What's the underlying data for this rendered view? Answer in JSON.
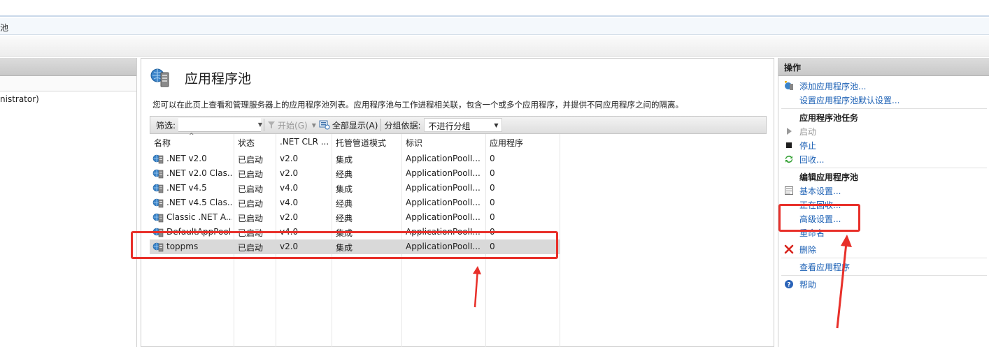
{
  "breadcrumb": "池",
  "connections": {
    "node_text": "nistrator)"
  },
  "content": {
    "title": "应用程序池",
    "description": "您可以在此页上查看和管理服务器上的应用程序池列表。应用程序池与工作进程相关联，包含一个或多个应用程序，并提供不同应用程序之间的隔离。"
  },
  "filter": {
    "label": "筛选:",
    "start_label": "开始(G)",
    "show_all_label": "全部显示(A)",
    "group_label": "分组依据:",
    "group_value": "不进行分组"
  },
  "grid": {
    "columns": [
      "名称",
      "状态",
      ".NET CLR ...",
      "托管管道模式",
      "标识",
      "应用程序"
    ],
    "rows": [
      {
        "name": ".NET v2.0",
        "status": "已启动",
        "clr": "v2.0",
        "pipeline": "集成",
        "identity": "ApplicationPoolI...",
        "apps": "0"
      },
      {
        "name": ".NET v2.0 Clas...",
        "status": "已启动",
        "clr": "v2.0",
        "pipeline": "经典",
        "identity": "ApplicationPoolI...",
        "apps": "0"
      },
      {
        "name": ".NET v4.5",
        "status": "已启动",
        "clr": "v4.0",
        "pipeline": "集成",
        "identity": "ApplicationPoolI...",
        "apps": "0"
      },
      {
        "name": ".NET v4.5 Clas...",
        "status": "已启动",
        "clr": "v4.0",
        "pipeline": "经典",
        "identity": "ApplicationPoolI...",
        "apps": "0"
      },
      {
        "name": "Classic .NET A...",
        "status": "已启动",
        "clr": "v2.0",
        "pipeline": "经典",
        "identity": "ApplicationPoolI...",
        "apps": "0"
      },
      {
        "name": "DefaultAppPool",
        "status": "已启动",
        "clr": "v4.0",
        "pipeline": "集成",
        "identity": "ApplicationPoolI...",
        "apps": "0"
      },
      {
        "name": "toppms",
        "status": "已启动",
        "clr": "v2.0",
        "pipeline": "集成",
        "identity": "ApplicationPoolI...",
        "apps": "0",
        "selected": true
      }
    ]
  },
  "actions": {
    "header": "操作",
    "add_pool": "添加应用程序池...",
    "set_defaults": "设置应用程序池默认设置...",
    "tasks_header": "应用程序池任务",
    "start": "启动",
    "stop": "停止",
    "recycle": "回收...",
    "edit_header": "编辑应用程序池",
    "basic_settings": "基本设置...",
    "recycling": "正在回收...",
    "advanced_settings": "高级设置...",
    "rename": "重命名",
    "delete": "删除",
    "view_apps": "查看应用程序",
    "help": "帮助"
  },
  "colors": {
    "annotation": "#e8302a",
    "link": "#1a5fb4",
    "selected_row": "#d9d9d9"
  }
}
